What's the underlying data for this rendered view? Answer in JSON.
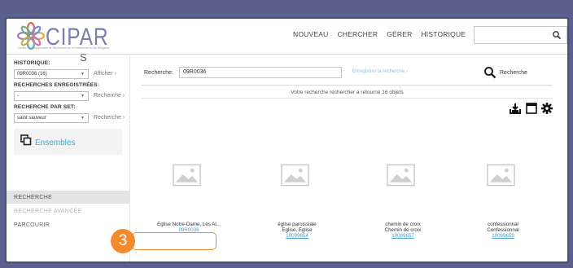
{
  "header": {
    "logo_text": "CIPAR",
    "logo_sub": "Centre Interdisciplinaire de Recherche sur le Patrimoine en Art Religieux",
    "nav": [
      "NOUVEAU",
      "CHERCHER",
      "GÉRER",
      "HISTORIQUE"
    ],
    "search_placeholder": ""
  },
  "sidebar": {
    "cut_text": "S",
    "historique_label": "HISTORIQUE:",
    "historique_value": "09R0036 (16)",
    "afficher": "Afficher ›",
    "recherches_label": "RECHERCHES ENREGISTRÉES:",
    "recherches_value": "-",
    "recherche_link": "Recherche ›",
    "par_set_label": "RECHERCHE PAR SET:",
    "par_set_value": "saint sauveur",
    "par_set_link": "Recherche ›",
    "ensembles": "Ensembles",
    "nav": {
      "recherche": "RECHERCHE",
      "recherche_avancee": "RECHERCHE AVANCÉE",
      "parcourir": "PARCOURIR"
    }
  },
  "main": {
    "search_label": "Recherche:",
    "search_value": "09R0036",
    "save_link": "Enregistrer la recherche ›",
    "search_button": "Recherche",
    "result_text": "Votre recherche rechercher a retourné 16 objets"
  },
  "results": [
    {
      "title1": "Eglise Notre-Dame, Les Al...",
      "title2": "",
      "code": "09R0036"
    },
    {
      "title1": "église paroissiale",
      "title2": "Eglise, Eglise",
      "code": "10099654"
    },
    {
      "title1": "chemin de croix",
      "title2": "Chemin de croix",
      "code": "10099657"
    },
    {
      "title1": "confessionnal",
      "title2": "Confessionnal",
      "code": "10099659"
    }
  ],
  "annotation": {
    "step": "3",
    "color": "#f48a2c"
  },
  "colors": {
    "accent": "#4aa7c9",
    "background": "#5b5f8c"
  }
}
